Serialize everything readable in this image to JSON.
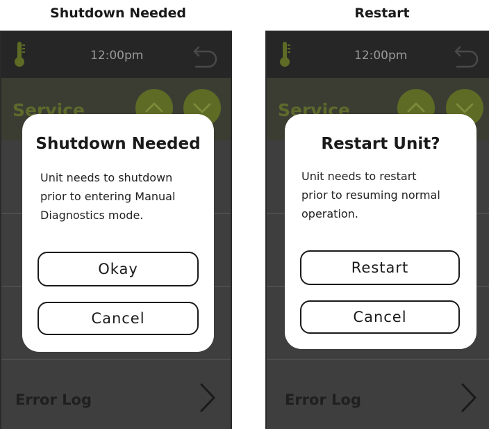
{
  "panels": [
    {
      "caption": "Shutdown Needed",
      "time": "12:00pm",
      "service_title": "Service",
      "error_log_label": "Error Log",
      "dialog": {
        "title": "Shutdown Needed",
        "message": "Unit needs to shutdown\nprior to entering Manual\nDiagnostics mode.",
        "primary_label": "Okay",
        "secondary_label": "Cancel"
      }
    },
    {
      "caption": "Restart",
      "time": "12:00pm",
      "service_title": "Service",
      "error_log_label": "Error Log",
      "dialog": {
        "title": "Restart Unit?",
        "message": "Unit needs to restart\nprior to resuming normal\noperation.",
        "primary_label": "Restart",
        "secondary_label": "Cancel"
      }
    }
  ],
  "icons": {
    "status": "thermometer-icon",
    "back": "back-arrow-icon",
    "scroll_up": "chevron-up-icon",
    "scroll_down": "chevron-down-icon",
    "error_log": "chevron-right-icon"
  },
  "colors": {
    "accent": "#6e7f26",
    "topbar": "#262626",
    "screen_background": "#3e3e3e",
    "dialog_background": "#ffffff"
  }
}
